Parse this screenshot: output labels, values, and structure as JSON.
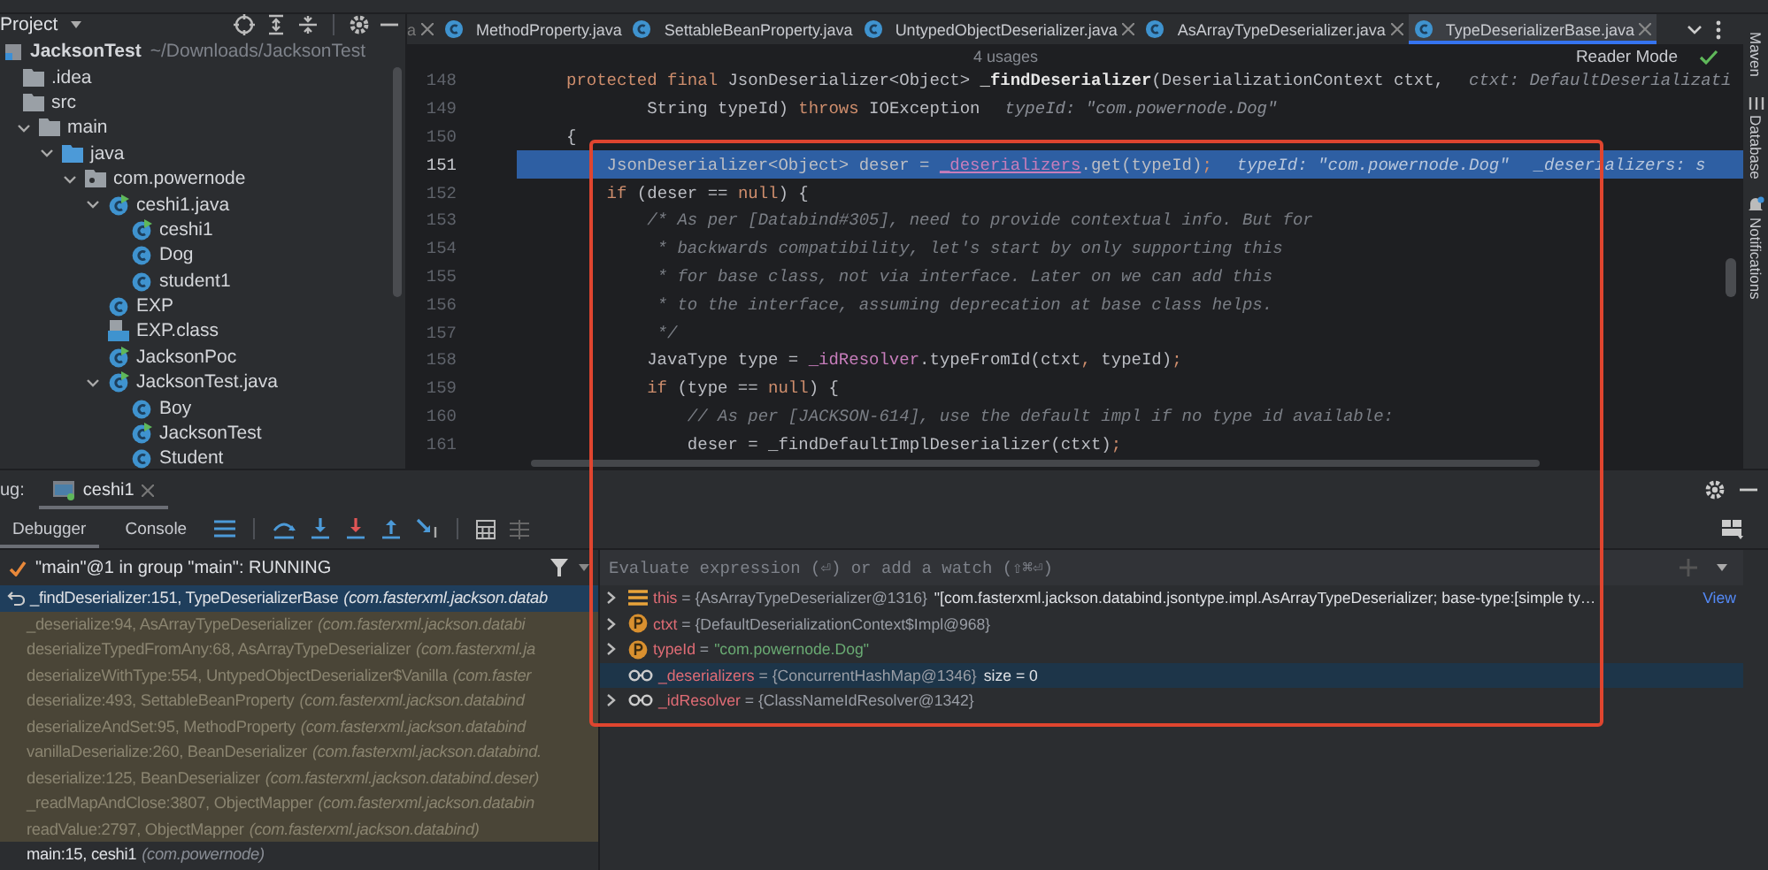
{
  "project_panel": {
    "title": "Project",
    "tree": [
      {
        "label": "JacksonTest",
        "kind": "module",
        "detail": "~/Downloads/JacksonTest",
        "children": [
          {
            "label": ".idea",
            "kind": "folder"
          },
          {
            "label": "src",
            "kind": "folder",
            "children": [
              {
                "label": "main",
                "kind": "folder",
                "expanded": true,
                "children": [
                  {
                    "label": "java",
                    "kind": "source-root",
                    "expanded": true,
                    "children": [
                      {
                        "label": "com.powernode",
                        "kind": "package",
                        "expanded": true,
                        "children": [
                          {
                            "label": "ceshi1.java",
                            "kind": "main-class",
                            "expanded": true,
                            "children": [
                              {
                                "label": "ceshi1",
                                "kind": "main-class"
                              },
                              {
                                "label": "Dog",
                                "kind": "class"
                              },
                              {
                                "label": "student1",
                                "kind": "class"
                              }
                            ]
                          },
                          {
                            "label": "EXP",
                            "kind": "class"
                          },
                          {
                            "label": "EXP.class",
                            "kind": "compiled"
                          },
                          {
                            "label": "JacksonPoc",
                            "kind": "main-class"
                          },
                          {
                            "label": "JacksonTest.java",
                            "kind": "main-class",
                            "expanded": true,
                            "children": [
                              {
                                "label": "Boy",
                                "kind": "class"
                              },
                              {
                                "label": "JacksonTest",
                                "kind": "main-class"
                              },
                              {
                                "label": "Student",
                                "kind": "class"
                              }
                            ]
                          }
                        ]
                      }
                    ]
                  }
                ]
              }
            ]
          }
        ]
      }
    ]
  },
  "editor": {
    "tabs": [
      {
        "label": "a",
        "closable": true,
        "selected": false
      },
      {
        "label": "MethodProperty.java",
        "closable": false,
        "selected": false
      },
      {
        "label": "SettableBeanProperty.java",
        "closable": false,
        "selected": false
      },
      {
        "label": "UntypedObjectDeserializer.java",
        "closable": true,
        "selected": false
      },
      {
        "label": "AsArrayTypeDeserializer.java",
        "closable": true,
        "selected": false
      },
      {
        "label": "TypeDeserializerBase.java",
        "closable": true,
        "selected": true
      }
    ],
    "usages": "4 usages",
    "reader_mode": "Reader Mode",
    "lines": [
      {
        "number": "148",
        "highlighted": false,
        "tokens": [
          {
            "kind": "kw",
            "text": "protected final "
          },
          {
            "kind": "plain",
            "text": "JsonDeserializer<Object> "
          },
          {
            "kind": "method",
            "text": "_findDeserializer"
          },
          {
            "kind": "plain",
            "text": "(DeserializationContext ctxt,"
          }
        ],
        "hints": [
          "ctxt: DefaultDeserializati"
        ]
      },
      {
        "number": "149",
        "highlighted": false,
        "tokens": [
          {
            "kind": "plain",
            "text": "        String typeId) "
          },
          {
            "kind": "kw",
            "text": "throws "
          },
          {
            "kind": "plain",
            "text": "IOException"
          }
        ],
        "hints": [
          "typeId: \"com.powernode.Dog\""
        ]
      },
      {
        "number": "150",
        "highlighted": false,
        "tokens": [
          {
            "kind": "plain",
            "text": "{"
          }
        ]
      },
      {
        "number": "151",
        "highlighted": true,
        "tokens": [
          {
            "kind": "plain",
            "text": "    JsonDeserializer<Object> deser = "
          },
          {
            "kind": "field",
            "text": "_deserializers"
          },
          {
            "kind": "plain",
            "text": ".get(typeId)"
          },
          {
            "kind": "kw",
            "text": ";"
          }
        ],
        "hints": [
          "typeId: \"com.powernode.Dog\"",
          "_deserializers: s"
        ]
      },
      {
        "number": "152",
        "highlighted": false,
        "tokens": [
          {
            "kind": "kw",
            "text": "    if "
          },
          {
            "kind": "plain",
            "text": "(deser == "
          },
          {
            "kind": "kw",
            "text": "null"
          },
          {
            "kind": "plain",
            "text": ") {"
          }
        ]
      },
      {
        "number": "153",
        "highlighted": false,
        "tokens": [
          {
            "kind": "comment",
            "text": "        /* As per [Databind#305], need to provide contextual info. But for"
          }
        ]
      },
      {
        "number": "154",
        "highlighted": false,
        "tokens": [
          {
            "kind": "comment",
            "text": "         * backwards compatibility, let's start by only supporting this"
          }
        ]
      },
      {
        "number": "155",
        "highlighted": false,
        "tokens": [
          {
            "kind": "comment",
            "text": "         * for base class, not via interface. Later on we can add this"
          }
        ]
      },
      {
        "number": "156",
        "highlighted": false,
        "tokens": [
          {
            "kind": "comment",
            "text": "         * to the interface, assuming deprecation at base class helps."
          }
        ]
      },
      {
        "number": "157",
        "highlighted": false,
        "tokens": [
          {
            "kind": "comment",
            "text": "         */"
          }
        ]
      },
      {
        "number": "158",
        "highlighted": false,
        "tokens": [
          {
            "kind": "plain",
            "text": "        JavaType type = "
          },
          {
            "kind": "field",
            "text": "_idResolver"
          },
          {
            "kind": "plain",
            "text": ".typeFromId(ctxt"
          },
          {
            "kind": "kw",
            "text": ", "
          },
          {
            "kind": "plain",
            "text": "typeId)"
          },
          {
            "kind": "kw",
            "text": ";"
          }
        ]
      },
      {
        "number": "159",
        "highlighted": false,
        "tokens": [
          {
            "kind": "kw",
            "text": "        if "
          },
          {
            "kind": "plain",
            "text": "(type == "
          },
          {
            "kind": "kw",
            "text": "null"
          },
          {
            "kind": "plain",
            "text": ") {"
          }
        ]
      },
      {
        "number": "160",
        "highlighted": false,
        "tokens": [
          {
            "kind": "comment",
            "text": "            // As per [JACKSON-614], use the default impl if no type id available:"
          }
        ]
      },
      {
        "number": "161",
        "highlighted": false,
        "tokens": [
          {
            "kind": "plain",
            "text": "            deser = _findDefaultImplDeserializer(ctxt)"
          },
          {
            "kind": "kw",
            "text": ";"
          }
        ]
      }
    ]
  },
  "tool_strip": [
    "Maven",
    "Database",
    "Notifications"
  ],
  "debug": {
    "label": "ug:",
    "session_tab": "ceshi1",
    "tabs": [
      {
        "label": "Debugger",
        "selected": true
      },
      {
        "label": "Console",
        "selected": false
      }
    ],
    "thread": "\"main\"@1 in group \"main\": RUNNING",
    "frames": [
      {
        "method": "_findDeserializer:151, TypeDeserializerBase",
        "package": "(com.fasterxml.jackson.datab",
        "library": false,
        "selected": true
      },
      {
        "method": "_deserialize:94, AsArrayTypeDeserializer",
        "package": "(com.fasterxml.jackson.databi",
        "library": true,
        "selected": false
      },
      {
        "method": "deserializeTypedFromAny:68, AsArrayTypeDeserializer",
        "package": "(com.fasterxml.ja",
        "library": true,
        "selected": false
      },
      {
        "method": "deserializeWithType:554, UntypedObjectDeserializer$Vanilla",
        "package": "(com.faster",
        "library": true,
        "selected": false
      },
      {
        "method": "deserialize:493, SettableBeanProperty",
        "package": "(com.fasterxml.jackson.databind",
        "library": true,
        "selected": false
      },
      {
        "method": "deserializeAndSet:95, MethodProperty",
        "package": "(com.fasterxml.jackson.databind",
        "library": true,
        "selected": false
      },
      {
        "method": "vanillaDeserialize:260, BeanDeserializer",
        "package": "(com.fasterxml.jackson.databind.",
        "library": true,
        "selected": false
      },
      {
        "method": "deserialize:125, BeanDeserializer",
        "package": "(com.fasterxml.jackson.databind.deser)",
        "library": true,
        "selected": false
      },
      {
        "method": "_readMapAndClose:3807, ObjectMapper",
        "package": "(com.fasterxml.jackson.databin",
        "library": true,
        "selected": false
      },
      {
        "method": "readValue:2797, ObjectMapper",
        "package": "(com.fasterxml.jackson.databind)",
        "library": true,
        "selected": false
      },
      {
        "method": "main:15, ceshi1",
        "package": "(com.powernode)",
        "library": false,
        "selected": false
      }
    ],
    "evaluate": {
      "placeholder": "Evaluate expression (⏎) or add a watch (⇧⌘⏎)"
    },
    "variables": [
      {
        "kind": "field",
        "expandable": true,
        "name": "this",
        "value": "= {AsArrayTypeDeserializer@1316}",
        "detail": "\"[com.fasterxml.jackson.databind.jsontype.impl.AsArrayTypeDeserializer; base-type:[simple ty…",
        "link": "View",
        "selected": false
      },
      {
        "kind": "param",
        "expandable": true,
        "name": "ctxt",
        "value": "= {DefaultDeserializationContext$Impl@968}",
        "selected": false
      },
      {
        "kind": "param",
        "expandable": true,
        "name": "typeId",
        "value": "=",
        "string": "\"com.powernode.Dog\"",
        "selected": false
      },
      {
        "kind": "watch",
        "expandable": false,
        "name": "_deserializers",
        "value": "= {ConcurrentHashMap@1346}",
        "detail": "size = 0",
        "selected": true
      },
      {
        "kind": "watch",
        "expandable": true,
        "name": "_idResolver",
        "value": "= {ClassNameIdResolver@1342}",
        "selected": false
      }
    ]
  }
}
